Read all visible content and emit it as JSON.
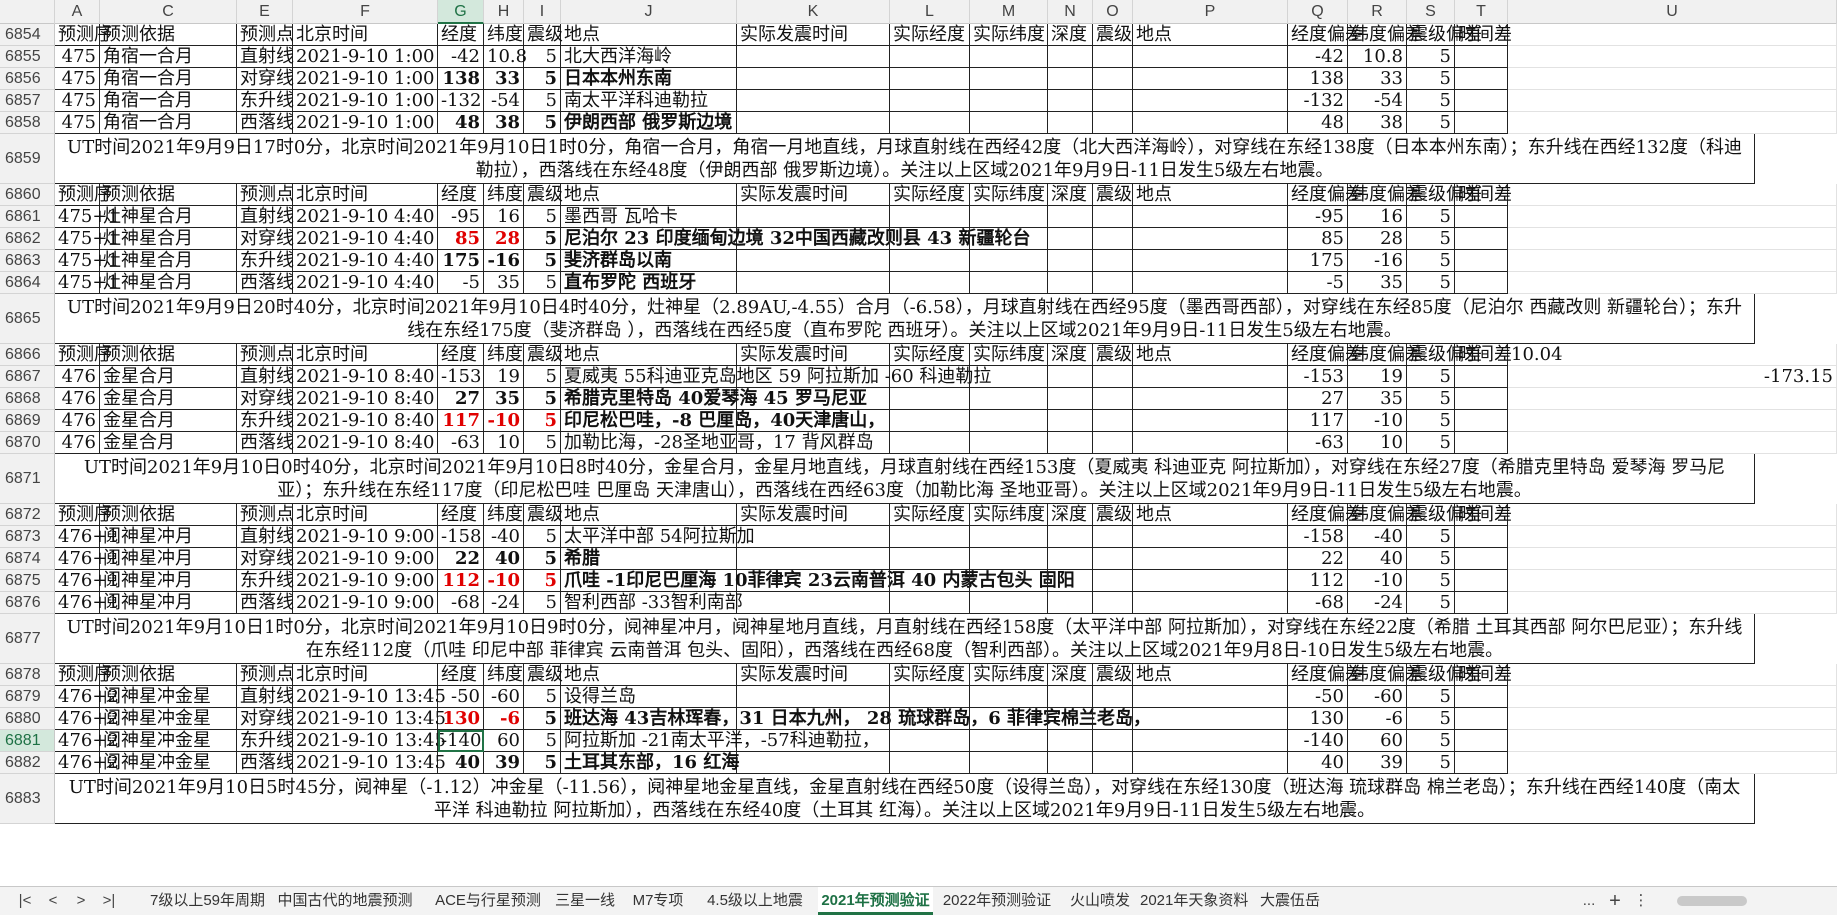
{
  "columns": [
    "A",
    "C",
    "E",
    "F",
    "G",
    "H",
    "I",
    "J",
    "K",
    "L",
    "M",
    "N",
    "O",
    "P",
    "Q",
    "R",
    "S",
    "T",
    "U"
  ],
  "selected_column": "G",
  "selected_row": "6881",
  "colors": {
    "accent": "#217346",
    "red": "#e00000"
  },
  "rows": [
    {
      "type": "header",
      "num": "6854",
      "cells": [
        "预测序",
        "预测依据",
        "预测点",
        "北京时间",
        "经度",
        "纬度",
        "震级",
        "地点",
        "实际发震时间",
        "实际经度",
        "实际纬度",
        "深度",
        "震级",
        "地点",
        "经度偏差",
        "纬度偏差",
        "震级偏差",
        "时间差",
        ""
      ]
    },
    {
      "type": "data",
      "num": "6855",
      "cells": [
        "475",
        "角宿一合月",
        "直射线",
        "2021-9-10 1:00",
        "-42",
        "10.8",
        "5",
        "北大西洋海岭",
        "",
        "",
        "",
        "",
        "",
        "",
        "-42",
        "10.8",
        "5",
        "",
        ""
      ]
    },
    {
      "type": "data",
      "num": "6856",
      "bold": [
        4,
        5,
        6,
        7
      ],
      "cells": [
        "475",
        "角宿一合月",
        "对穿线",
        "2021-9-10 1:00",
        "138",
        "33",
        "5",
        "日本本州东南",
        "",
        "",
        "",
        "",
        "",
        "",
        "138",
        "33",
        "5",
        "",
        ""
      ]
    },
    {
      "type": "data",
      "num": "6857",
      "cells": [
        "475",
        "角宿一合月",
        "东升线",
        "2021-9-10 1:00",
        "-132",
        "-54",
        "5",
        "南太平洋科迪勒拉",
        "",
        "",
        "",
        "",
        "",
        "",
        "-132",
        "-54",
        "5",
        "",
        ""
      ]
    },
    {
      "type": "data",
      "num": "6858",
      "bold": [
        4,
        5,
        6,
        7
      ],
      "cells": [
        "475",
        "角宿一合月",
        "西落线",
        "2021-9-10 1:00",
        "48",
        "38",
        "5",
        "伊朗西部 俄罗斯边境",
        "",
        "",
        "",
        "",
        "",
        "",
        "48",
        "38",
        "5",
        "",
        ""
      ]
    },
    {
      "type": "note",
      "num": "6859",
      "text": "UT时间2021年9月9日17时0分，北京时间2021年9月10日1时0分，角宿一合月，角宿一月地直线，月球直射线在西经42度（北大西洋海岭），对穿线在东经138度（日本本州东南）；东升线在西经132度（科迪勒拉），西落线在东经48度（伊朗西部 俄罗斯边境）。关注以上区域2021年9月9日-11日发生5级左右地震。"
    },
    {
      "type": "header",
      "num": "6860",
      "cells": [
        "预测序",
        "预测依据",
        "预测点",
        "北京时间",
        "经度",
        "纬度",
        "震级",
        "地点",
        "实际发震时间",
        "实际经度",
        "实际纬度",
        "深度",
        "震级",
        "地点",
        "经度偏差",
        "纬度偏差",
        "震级偏差",
        "时间差",
        ""
      ]
    },
    {
      "type": "data",
      "num": "6861",
      "cells": [
        "475+1",
        "灶神星合月",
        "直射线",
        "2021-9-10 4:40",
        "-95",
        "16",
        "5",
        "墨西哥 瓦哈卡",
        "",
        "",
        "",
        "",
        "",
        "",
        "-95",
        "16",
        "5",
        "",
        ""
      ]
    },
    {
      "type": "data",
      "num": "6862",
      "bold": [
        4,
        5,
        6,
        7
      ],
      "red": [
        4,
        5
      ],
      "cells": [
        "475+1",
        "灶神星合月",
        "对穿线",
        "2021-9-10 4:40",
        "85",
        "28",
        "5",
        "尼泊尔 23 印度缅甸边境 32中国西藏改则县 43 新疆轮台",
        "",
        "",
        "",
        "",
        "",
        "",
        "85",
        "28",
        "5",
        "",
        ""
      ]
    },
    {
      "type": "data",
      "num": "6863",
      "bold": [
        4,
        5,
        6,
        7
      ],
      "cells": [
        "475+1",
        "灶神星合月",
        "东升线",
        "2021-9-10 4:40",
        "175",
        "-16",
        "5",
        "斐济群岛以南",
        "",
        "",
        "",
        "",
        "",
        "",
        "175",
        "-16",
        "5",
        "",
        ""
      ]
    },
    {
      "type": "data",
      "num": "6864",
      "bold": [
        7
      ],
      "cells": [
        "475+1",
        "灶神星合月",
        "西落线",
        "2021-9-10 4:40",
        "-5",
        "35",
        "5",
        "直布罗陀 西班牙",
        "",
        "",
        "",
        "",
        "",
        "",
        "-5",
        "35",
        "5",
        "",
        ""
      ]
    },
    {
      "type": "note",
      "num": "6865",
      "text": "UT时间2021年9月9日20时40分，北京时间2021年9月10日4时40分，灶神星（2.89AU,-4.55）合月（-6.58），月球直射线在西经95度（墨西哥西部），对穿线在东经85度（尼泊尔 西藏改则 新疆轮台）；东升线在东经175度（斐济群岛 ），西落线在西经5度（直布罗陀 西班牙）。关注以上区域2021年9月9日-11日发生5级左右地震。"
    },
    {
      "type": "header",
      "num": "6866",
      "cells": [
        "预测序",
        "预测依据",
        "预测点",
        "北京时间",
        "经度",
        "纬度",
        "震级",
        "地点",
        "实际发震时间",
        "实际经度",
        "实际纬度",
        "深度",
        "震级",
        "地点",
        "经度偏差",
        "纬度偏差",
        "震级偏差",
        "时间差",
        "10.04"
      ]
    },
    {
      "type": "data",
      "num": "6867",
      "cells": [
        "476",
        "金星合月",
        "直射线",
        "2021-9-10 8:40",
        "-153",
        "19",
        "5",
        "夏威夷 55科迪亚克岛地区  59 阿拉斯加 -60 科迪勒拉",
        "",
        "",
        "",
        "",
        "",
        "",
        "-153",
        "19",
        "5",
        "",
        "-173.15"
      ]
    },
    {
      "type": "data",
      "num": "6868",
      "bold": [
        4,
        5,
        6,
        7
      ],
      "cells": [
        "476",
        "金星合月",
        "对穿线",
        "2021-9-10 8:40",
        "27",
        "35",
        "5",
        "希腊克里特岛 40爱琴海  45 罗马尼亚",
        "",
        "",
        "",
        "",
        "",
        "",
        "27",
        "35",
        "5",
        "",
        ""
      ]
    },
    {
      "type": "data",
      "num": "6869",
      "bold": [
        4,
        5,
        6,
        7
      ],
      "red": [
        4,
        5,
        6
      ],
      "cells": [
        "476",
        "金星合月",
        "东升线",
        "2021-9-10 8:40",
        "117",
        "-10",
        "5",
        "印尼松巴哇，-8 巴厘岛，40天津唐山，",
        "",
        "",
        "",
        "",
        "",
        "",
        "117",
        "-10",
        "5",
        "",
        ""
      ]
    },
    {
      "type": "data",
      "num": "6870",
      "cells": [
        "476",
        "金星合月",
        "西落线",
        "2021-9-10 8:40",
        "-63",
        "10",
        "5",
        "加勒比海，-28圣地亚哥，17 背风群岛",
        "",
        "",
        "",
        "",
        "",
        "",
        "-63",
        "10",
        "5",
        "",
        ""
      ]
    },
    {
      "type": "note",
      "num": "6871",
      "text": "UT时间2021年9月10日0时40分，北京时间2021年9月10日8时40分，金星合月，金星月地直线，月球直射线在西经153度（夏威夷 科迪亚克 阿拉斯加），对穿线在东经27度（希腊克里特岛 爱琴海 罗马尼亚）；东升线在东经117度（印尼松巴哇 巴厘岛 天津唐山），西落线在西经63度（加勒比海 圣地亚哥）。关注以上区域2021年9月9日-11日发生5级左右地震。"
    },
    {
      "type": "header",
      "num": "6872",
      "cells": [
        "预测序",
        "预测依据",
        "预测点",
        "北京时间",
        "经度",
        "纬度",
        "震级",
        "地点",
        "实际发震时间",
        "实际经度",
        "实际纬度",
        "深度",
        "震级",
        "地点",
        "经度偏差",
        "纬度偏差",
        "震级偏差",
        "时间差",
        ""
      ]
    },
    {
      "type": "data",
      "num": "6873",
      "cells": [
        "476+1",
        "阋神星冲月",
        "直射线",
        "2021-9-10 9:00",
        "-158",
        "-40",
        "5",
        "太平洋中部 54阿拉斯加",
        "",
        "",
        "",
        "",
        "",
        "",
        "-158",
        "-40",
        "5",
        "",
        ""
      ]
    },
    {
      "type": "data",
      "num": "6874",
      "bold": [
        4,
        5,
        6,
        7
      ],
      "cells": [
        "476+1",
        "阋神星冲月",
        "对穿线",
        "2021-9-10 9:00",
        "22",
        "40",
        "5",
        "希腊",
        "",
        "",
        "",
        "",
        "",
        "",
        "22",
        "40",
        "5",
        "",
        ""
      ]
    },
    {
      "type": "data",
      "num": "6875",
      "bold": [
        4,
        5,
        6,
        7
      ],
      "red": [
        4,
        5,
        6
      ],
      "cells": [
        "476+1",
        "阋神星冲月",
        "东升线",
        "2021-9-10 9:00",
        "112",
        "-10",
        "5",
        "爪哇 -1印尼巴厘海 10菲律宾 23云南普洱 40 内蒙古包头 固阳",
        "",
        "",
        "",
        "",
        "",
        "",
        "112",
        "-10",
        "5",
        "",
        ""
      ]
    },
    {
      "type": "data",
      "num": "6876",
      "cells": [
        "476+1",
        "阋神星冲月",
        "西落线",
        "2021-9-10 9:00",
        "-68",
        "-24",
        "5",
        "智利西部 -33智利南部",
        "",
        "",
        "",
        "",
        "",
        "",
        "-68",
        "-24",
        "5",
        "",
        ""
      ]
    },
    {
      "type": "note",
      "num": "6877",
      "text": "UT时间2021年9月10日1时0分，北京时间2021年9月10日9时0分，阋神星冲月，阋神星地月直线，月直射线在西经158度（太平洋中部 阿拉斯加），对穿线在东经22度（希腊 土耳其西部 阿尔巴尼亚）；东升线在东经112度（爪哇 印尼中部 菲律宾 云南普洱 包头、固阳），西落线在西经68度（智利西部）。关注以上区域2021年9月8日-10日发生5级左右地震。"
    },
    {
      "type": "header",
      "num": "6878",
      "cells": [
        "预测序",
        "预测依据",
        "预测点",
        "北京时间",
        "经度",
        "纬度",
        "震级",
        "地点",
        "实际发震时间",
        "实际经度",
        "实际纬度",
        "深度",
        "震级",
        "地点",
        "经度偏差",
        "纬度偏差",
        "震级偏差",
        "时间差",
        ""
      ]
    },
    {
      "type": "data",
      "num": "6879",
      "cells": [
        "476+2",
        "阋神星冲金星",
        "直射线",
        "2021-9-10 13:45",
        "-50",
        "-60",
        "5",
        "设得兰岛",
        "",
        "",
        "",
        "",
        "",
        "",
        "-50",
        "-60",
        "5",
        "",
        ""
      ]
    },
    {
      "type": "data",
      "num": "6880",
      "bold": [
        4,
        5,
        6,
        7
      ],
      "red": [
        4,
        5
      ],
      "cells": [
        "476+2",
        "阋神星冲金星",
        "对穿线",
        "2021-9-10 13:45",
        "130",
        "-6",
        "5",
        "班达海 43吉林珲春，31 日本九州， 28 琉球群岛，6 菲律宾棉兰老岛，",
        "",
        "",
        "",
        "",
        "",
        "",
        "130",
        "-6",
        "5",
        "",
        ""
      ]
    },
    {
      "type": "data",
      "num": "6881",
      "active": 4,
      "cells": [
        "476+2",
        "阋神星冲金星",
        "东升线",
        "2021-9-10 13:45",
        "-140",
        "60",
        "5",
        "阿拉斯加 -21南太平洋，-57科迪勒拉，",
        "",
        "",
        "",
        "",
        "",
        "",
        "-140",
        "60",
        "5",
        "",
        ""
      ]
    },
    {
      "type": "data",
      "num": "6882",
      "bold": [
        4,
        5,
        6,
        7
      ],
      "cells": [
        "476+2",
        "阋神星冲金星",
        "西落线",
        "2021-9-10 13:45",
        "40",
        "39",
        "5",
        "土耳其东部，16 红海",
        "",
        "",
        "",
        "",
        "",
        "",
        "40",
        "39",
        "5",
        "",
        ""
      ]
    },
    {
      "type": "note",
      "num": "6883",
      "text": "UT时间2021年9月10日5时45分，阋神星（-1.12）冲金星（-11.56），阋神星地金星直线，金星直射线在西经50度（设得兰岛），对穿线在东经130度（班达海 琉球群岛 棉兰老岛）；东升线在西经140度（南太平洋 科迪勒拉 阿拉斯加），西落线在东经40度（土耳其 红海）。关注以上区域2021年9月9日-11日发生5级左右地震。"
    }
  ],
  "tabs": [
    {
      "label": "7级以上59年周期"
    },
    {
      "label": "中国古代的地震预测"
    },
    {
      "label": "ACE与行星预测"
    },
    {
      "label": "三星一线"
    },
    {
      "label": "M7专项"
    },
    {
      "label": "4.5级以上地震"
    },
    {
      "label": "2021年预测验证",
      "active": true
    },
    {
      "label": "2022年预测验证"
    },
    {
      "label": "火山喷发"
    },
    {
      "label": "2021年天象资料"
    },
    {
      "label": "大震伍岳"
    }
  ],
  "nav": {
    "first": "|<",
    "prev": "<",
    "next": ">",
    "last": ">|",
    "more": "...",
    "add": "+",
    "menu": "⋮"
  }
}
